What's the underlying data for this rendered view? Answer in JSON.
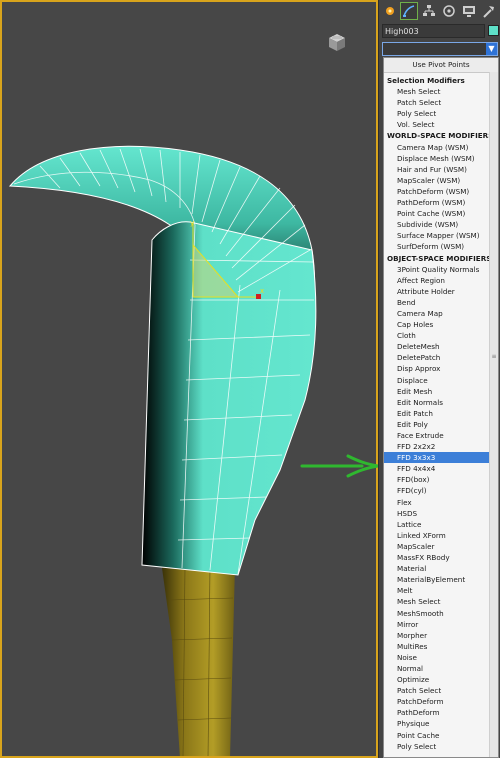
{
  "command_panel": {
    "tabs": [
      "create-icon",
      "modify-icon",
      "hierarchy-icon",
      "motion-icon",
      "display-icon",
      "utilities-icon"
    ],
    "active_tab": "modify-icon",
    "object_name": "High003",
    "object_color": "#5ee0c8",
    "modifier_dropdown_value": "",
    "use_pivot_points_label": "Use Pivot Points",
    "modifier_list": [
      {
        "label": "Selection Modifiers",
        "header": true
      },
      {
        "label": "Mesh Select"
      },
      {
        "label": "Patch Select"
      },
      {
        "label": "Poly Select"
      },
      {
        "label": "Vol. Select"
      },
      {
        "label": "WORLD-SPACE MODIFIERS",
        "header": true
      },
      {
        "label": "Camera Map (WSM)"
      },
      {
        "label": "Displace Mesh (WSM)"
      },
      {
        "label": "Hair and Fur (WSM)"
      },
      {
        "label": "MapScaler (WSM)"
      },
      {
        "label": "PatchDeform (WSM)"
      },
      {
        "label": "PathDeform (WSM)"
      },
      {
        "label": "Point Cache (WSM)"
      },
      {
        "label": "Subdivide (WSM)"
      },
      {
        "label": "Surface Mapper (WSM)"
      },
      {
        "label": "SurfDeform (WSM)"
      },
      {
        "label": "OBJECT-SPACE MODIFIERS",
        "header": true
      },
      {
        "label": "3Point Quality Normals"
      },
      {
        "label": "Affect Region"
      },
      {
        "label": "Attribute Holder"
      },
      {
        "label": "Bend"
      },
      {
        "label": "Camera Map"
      },
      {
        "label": "Cap Holes"
      },
      {
        "label": "Cloth"
      },
      {
        "label": "DeleteMesh"
      },
      {
        "label": "DeletePatch"
      },
      {
        "label": "Disp Approx"
      },
      {
        "label": "Displace"
      },
      {
        "label": "Edit Mesh"
      },
      {
        "label": "Edit Normals"
      },
      {
        "label": "Edit Patch"
      },
      {
        "label": "Edit Poly"
      },
      {
        "label": "Face Extrude"
      },
      {
        "label": "FFD 2x2x2"
      },
      {
        "label": "FFD 3x3x3",
        "selected": true
      },
      {
        "label": "FFD 4x4x4"
      },
      {
        "label": "FFD(box)"
      },
      {
        "label": "FFD(cyl)"
      },
      {
        "label": "Flex"
      },
      {
        "label": "HSDS"
      },
      {
        "label": "Lattice"
      },
      {
        "label": "Linked XForm"
      },
      {
        "label": "MapScaler"
      },
      {
        "label": "MassFX RBody"
      },
      {
        "label": "Material"
      },
      {
        "label": "MaterialByElement"
      },
      {
        "label": "Melt"
      },
      {
        "label": "Mesh Select"
      },
      {
        "label": "MeshSmooth"
      },
      {
        "label": "Mirror"
      },
      {
        "label": "Morpher"
      },
      {
        "label": "MultiRes"
      },
      {
        "label": "Noise"
      },
      {
        "label": "Normal"
      },
      {
        "label": "Optimize"
      },
      {
        "label": "Patch Select"
      },
      {
        "label": "PatchDeform"
      },
      {
        "label": "PathDeform"
      },
      {
        "label": "Physique"
      },
      {
        "label": "Point Cache"
      },
      {
        "label": "Poly Select"
      }
    ]
  },
  "viewport": {
    "border_color": "#d8a41c",
    "blade_color": "#5ee0c8",
    "handle_color": "#a89020",
    "annotation_arrow_color": "#2fb82f"
  }
}
